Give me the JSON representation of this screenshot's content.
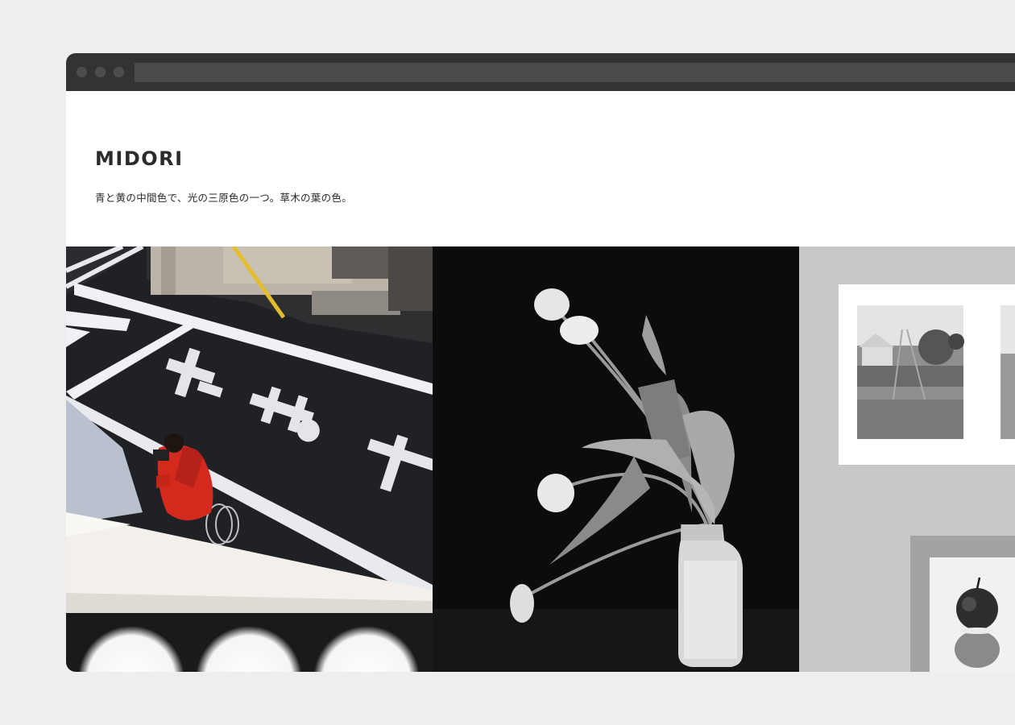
{
  "site": {
    "title": "MIDORI",
    "tagline": "青と黄の中間色で、光の三原色の一つ。草木の葉の色。"
  },
  "gallery": {
    "items": [
      {
        "name": "street-cyclist-photo",
        "subject": "woman in red coat riding bicycle on street with road markings"
      },
      {
        "name": "tulips-vase-photo",
        "subject": "white tulips in a glass bottle on black background"
      },
      {
        "name": "framed-prints-photo",
        "subject": "framed black and white prints on grey wall"
      },
      {
        "name": "blurred-circles-photo",
        "subject": "blurred white circles on dark background"
      }
    ]
  },
  "colors": {
    "page_bg": "#eeeeee",
    "chrome": "#333333",
    "title_text": "#2b2b2b",
    "coat_red": "#d42a1e"
  }
}
